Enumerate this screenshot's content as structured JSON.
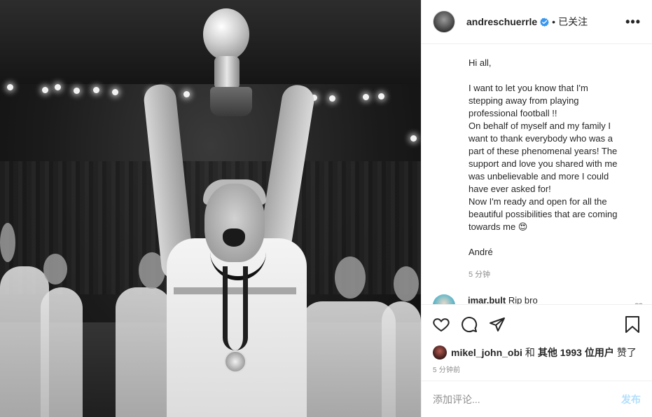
{
  "post": {
    "username": "andreschuerrle",
    "dot": "•",
    "follow_state": "已关注",
    "more": "•••",
    "caption": [
      "Hi all,",
      "",
      "I want to let you know that I'm",
      "stepping away from playing",
      "professional football !!",
      "On behalf of myself and my family I",
      "want to thank everybody who was a",
      "part of these phenomenal years! The",
      "support and love you shared with me",
      "was unbelievable and more I could",
      "have ever asked for!",
      "Now I'm ready and open for all the",
      "beautiful possibilities that are coming",
      "towards me 😍",
      "",
      "André"
    ],
    "caption_time": "5 分钟",
    "comment": {
      "user": "imar.bult",
      "text": "Rip bro"
    },
    "likes": {
      "user": "mikel_john_obi",
      "and": "和",
      "others": "其他 1993 位用户",
      "liked": "赞了"
    },
    "post_time": "5 分钟前",
    "add_comment_placeholder": "添加评论...",
    "publish_label": "发布"
  },
  "colors": {
    "verified": "#3897f0",
    "publish": "#b2dffc",
    "muted": "#8e8e8e"
  },
  "icons": [
    "verified-badge-icon",
    "heart-icon",
    "comment-icon",
    "share-icon",
    "bookmark-icon",
    "small-heart-icon"
  ]
}
